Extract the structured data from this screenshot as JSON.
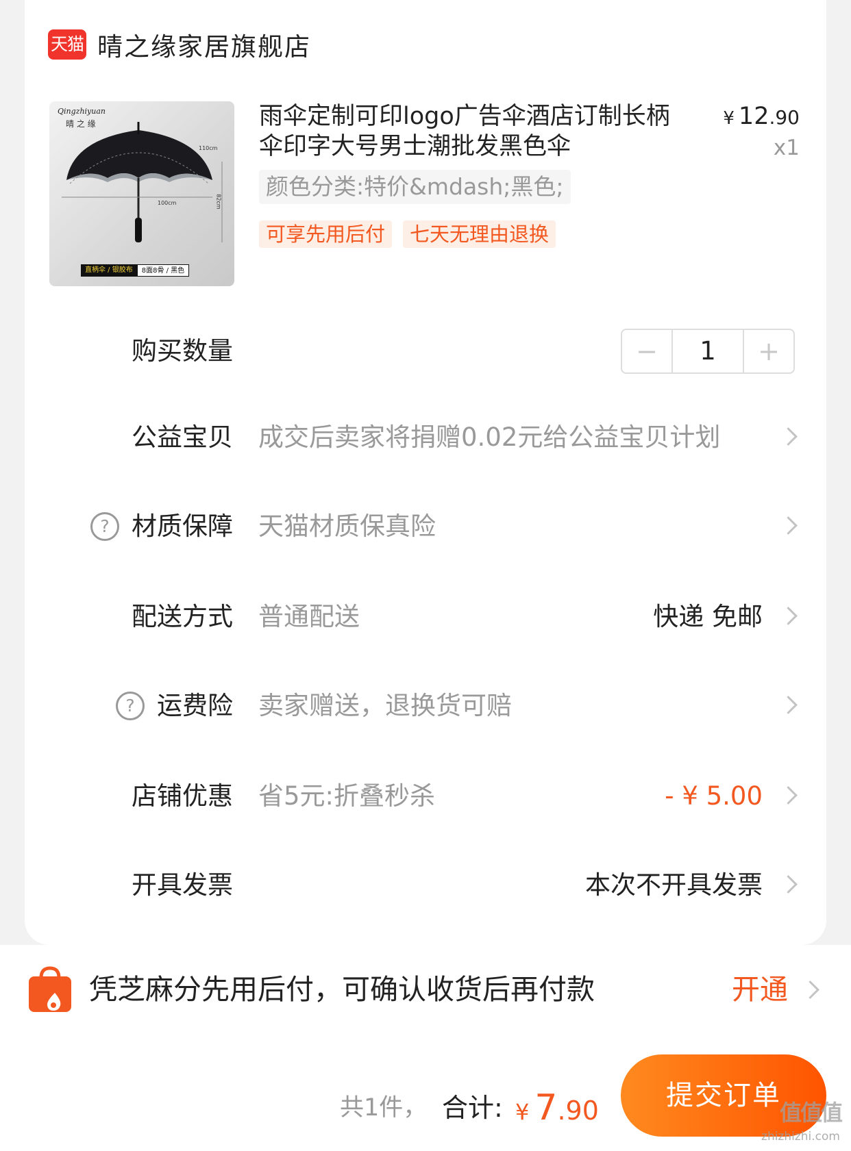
{
  "shop": {
    "platform_badge": "天猫",
    "name": "晴之缘家居旗舰店"
  },
  "product": {
    "image": {
      "brand_en": "Qingzhiyuan",
      "brand_cn": "晴 之 缘",
      "dim_top": "110cm",
      "dim_width": "100cm",
      "dim_height": "82cm",
      "strip_left": "直柄伞 / 银胶布",
      "strip_right": "8面8骨 / 黑色"
    },
    "title": "雨伞定制可印logo广告伞酒店订制长柄伞印字大号男士潮批发黑色伞",
    "price_symbol": "¥",
    "price_int": "12",
    "price_dec": ".90",
    "quantity_label": "x1",
    "sku": "颜色分类:特价&mdash;黑色;",
    "tags": [
      "可享先用后付",
      "七天无理由退换"
    ]
  },
  "rows": {
    "quantity": {
      "label": "购买数量",
      "minus": "−",
      "value": "1",
      "plus": "+"
    },
    "charity": {
      "label": "公益宝贝",
      "value": "成交后卖家将捐赠0.02元给公益宝贝计划"
    },
    "material": {
      "label": "材质保障",
      "value": "天猫材质保真险",
      "help": "?"
    },
    "delivery": {
      "label": "配送方式",
      "value": "普通配送",
      "right": "快递 免邮"
    },
    "freight_insurance": {
      "label": "运费险",
      "value": "卖家赠送，退换货可赔",
      "help": "?"
    },
    "shop_discount": {
      "label": "店铺优惠",
      "value": "省5元:折叠秒杀",
      "right": "- ¥ 5.00"
    },
    "invoice": {
      "label": "开具发票",
      "right": "本次不开具发票"
    }
  },
  "pay_later": {
    "text": "凭芝麻分先用后付，可确认收货后再付款",
    "action": "开通"
  },
  "footer": {
    "count": "共1件，",
    "total_label": "合计:",
    "total_symbol": "¥",
    "total_int": "7",
    "total_dec": ".90",
    "submit": "提交订单"
  },
  "watermark": {
    "text": "值值值",
    "url": "zhizhizhi.com"
  },
  "colors": {
    "accent": "#f2581f",
    "tmall_red": "#f0342b",
    "button_start": "#ff8a1f",
    "button_end": "#ff5400"
  }
}
